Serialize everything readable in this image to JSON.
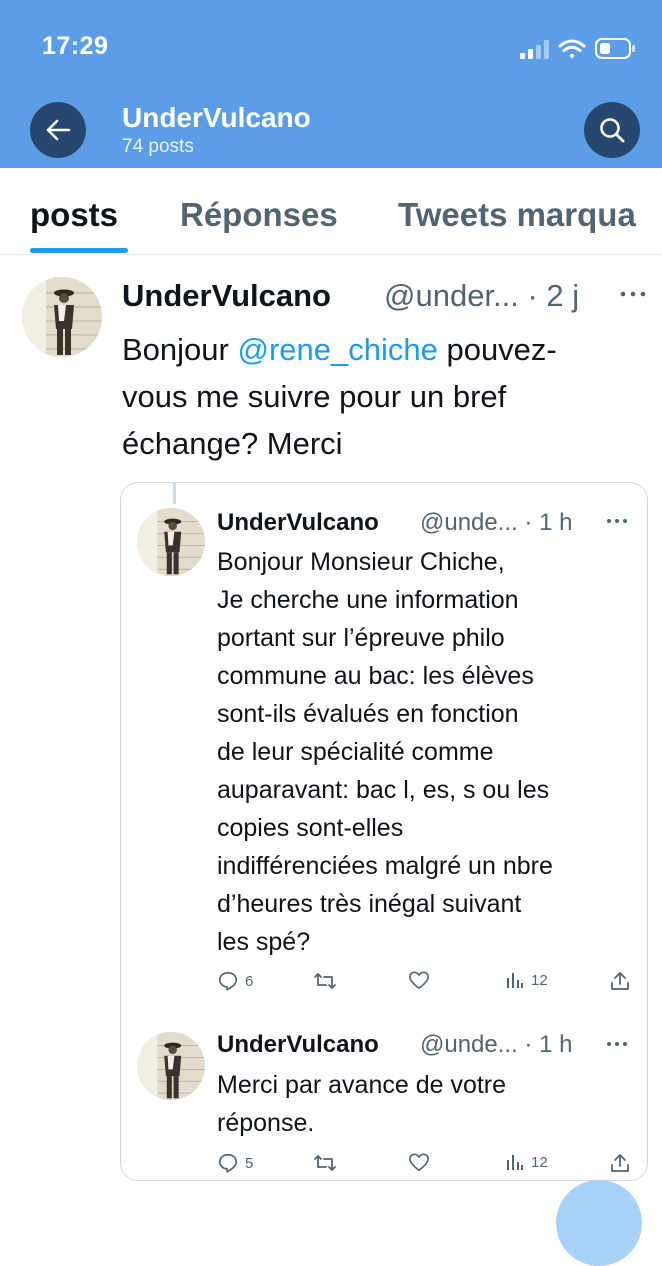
{
  "status_bar": {
    "time": "17:29"
  },
  "header": {
    "name": "UnderVulcano",
    "posts_count": "74 posts"
  },
  "tabs": [
    {
      "label": "posts",
      "active": true
    },
    {
      "label": "Réponses",
      "active": false
    },
    {
      "label": "Tweets marqua",
      "active": false
    }
  ],
  "tweet_main": {
    "name": "UnderVulcano",
    "handle_time": "@under... · 2 j",
    "text_before": "Bonjour ",
    "mention": "@rene_chiche",
    "text_after": " pouvez-\nvous me suivre pour un bref\néchange? Merci"
  },
  "reply_1": {
    "name": "UnderVulcano",
    "handle_time": "@unde... · 1 h",
    "text": "Bonjour Monsieur Chiche,\nJe cherche une information\nportant sur l’épreuve philo\ncommune au bac: les élèves\nsont-ils évalués en fonction\nde leur spécialité comme\nauparavant: bac l, es, s ou les\ncopies sont-elles\nindifférenciées malgré un nbre\nd’heures très inégal suivant\nles spé?",
    "replies": "6",
    "views": "12"
  },
  "reply_2": {
    "name": "UnderVulcano",
    "handle_time": "@unde... · 1 h",
    "text": "Merci par avance de votre\nréponse.",
    "replies": "5",
    "views": "12"
  },
  "colors": {
    "header_bg": "#5b9ee6",
    "header_button": "#27486e",
    "accent": "#1d9bf0",
    "muted": "#536471"
  }
}
